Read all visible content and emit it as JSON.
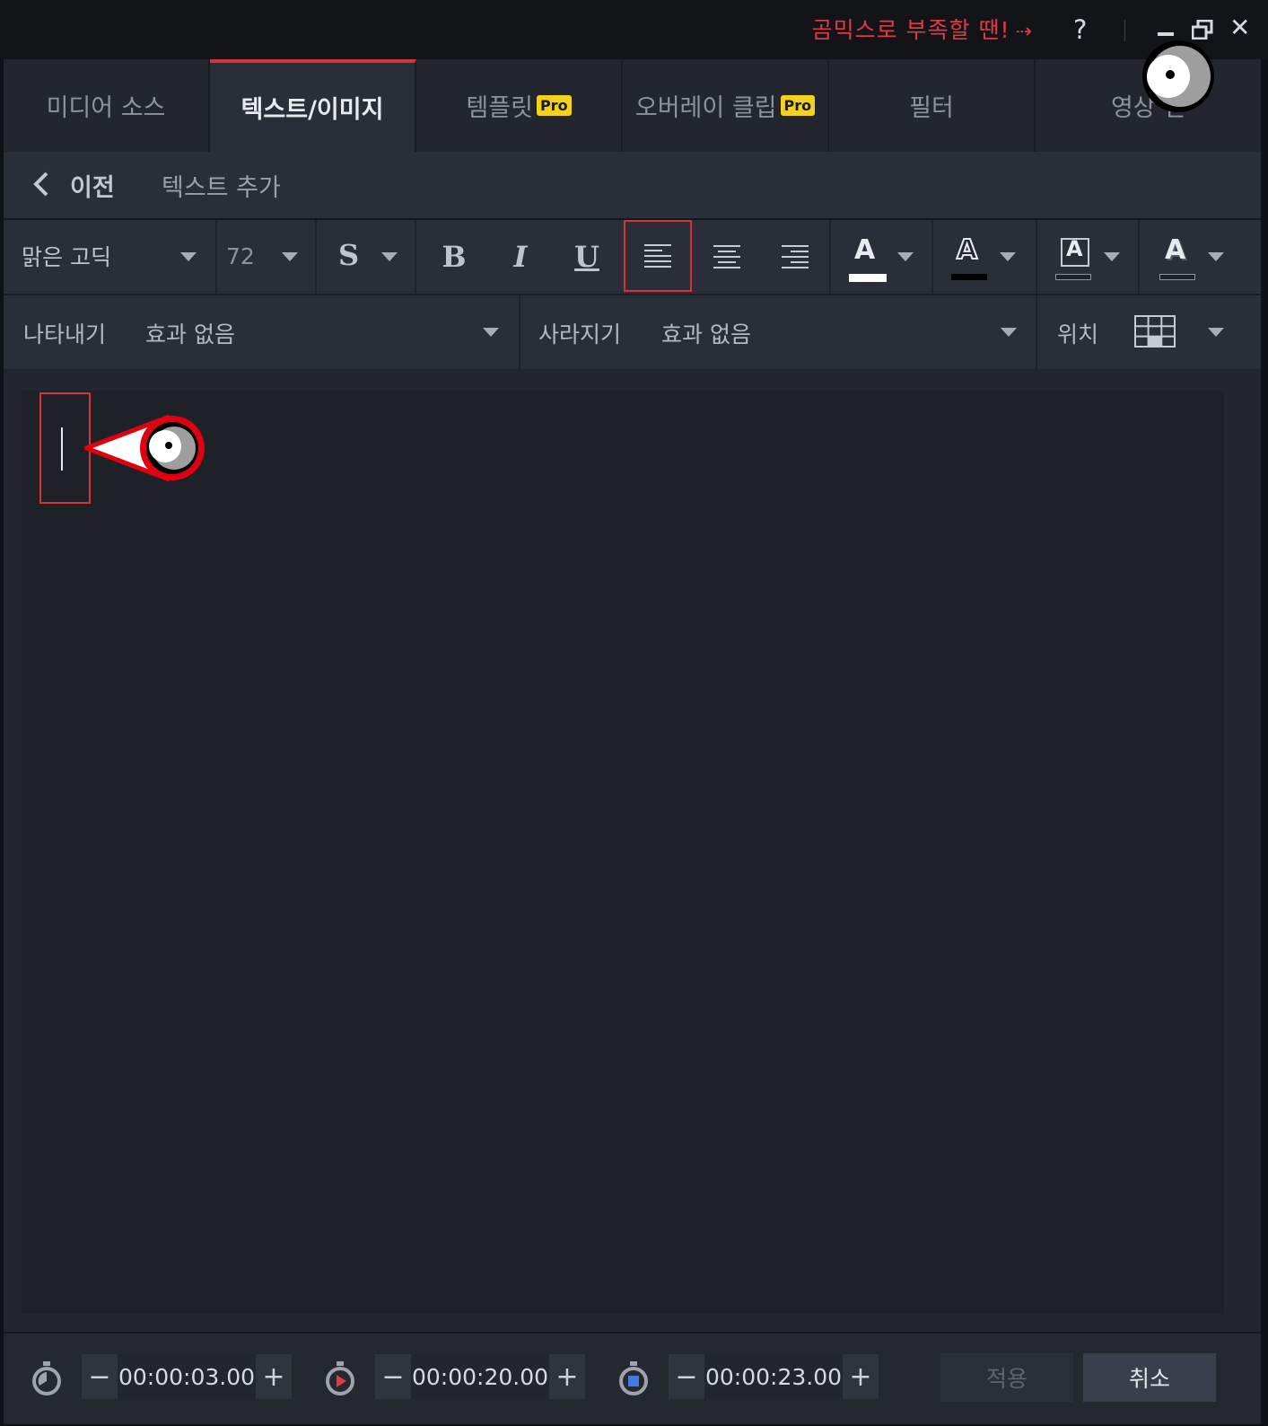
{
  "titlebar": {
    "promo_text": "곰믹스로 부족할 땐!",
    "promo_arrow": "⇢",
    "help": "?",
    "close": "✕"
  },
  "tabs": [
    {
      "label": "미디어 소스",
      "pro": ""
    },
    {
      "label": "텍스트/이미지",
      "pro": "",
      "active": true
    },
    {
      "label": "템플릿",
      "pro": "Pro"
    },
    {
      "label": "오버레이 클립",
      "pro": "Pro"
    },
    {
      "label": "필터",
      "pro": ""
    },
    {
      "label": "영상 전",
      "pro": ""
    }
  ],
  "subheader": {
    "back_label": "이전",
    "title": "텍스트 추가"
  },
  "toolbar": {
    "font_family": "맑은 고딕",
    "font_size": "72",
    "shadow": "S",
    "bold": "B",
    "italic": "I",
    "underline": "U",
    "color_letter": "A",
    "colors": {
      "text": "#ffffff",
      "outline": "#000000",
      "background": "#1f2129",
      "shadow": "#1f2129",
      "selected_outline": "#d8323c"
    }
  },
  "effects": {
    "appear_label": "나타내기",
    "appear_value": "효과 없음",
    "disappear_label": "사라지기",
    "disappear_value": "효과 없음",
    "position_label": "위치"
  },
  "timing": {
    "start": "00:00:03.00",
    "duration": "00:00:20.00",
    "end": "00:00:23.00",
    "minus": "−",
    "plus": "+"
  },
  "actions": {
    "apply": "적용",
    "cancel": "취소"
  }
}
